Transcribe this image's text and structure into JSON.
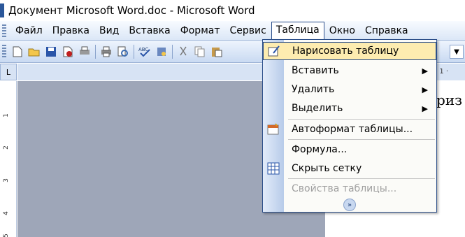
{
  "window": {
    "title": "Документ Microsoft Word.doc - Microsoft Word"
  },
  "menubar": {
    "items": [
      {
        "label": "Файл"
      },
      {
        "label": "Правка"
      },
      {
        "label": "Вид"
      },
      {
        "label": "Вставка"
      },
      {
        "label": "Формат"
      },
      {
        "label": "Сервис"
      },
      {
        "label": "Таблица"
      },
      {
        "label": "Окно"
      },
      {
        "label": "Справка"
      }
    ]
  },
  "toolbar": {
    "icons": [
      "new-document-icon",
      "open-icon",
      "save-icon",
      "permission-icon",
      "print-preview-icon",
      "print-icon",
      "research-icon",
      "spelling-icon",
      "cut-icon",
      "copy-icon",
      "paste-icon"
    ],
    "dropdown_arrow": "▼"
  },
  "ruler": {
    "corner": "L",
    "right_marks": "· 1 ·",
    "v_marks": [
      "1",
      "2",
      "3",
      "4",
      "5"
    ]
  },
  "document": {
    "visible_text": "ориз"
  },
  "table_menu": {
    "items": [
      {
        "label": "Нарисовать таблицу",
        "icon": "draw-table-icon",
        "highlight": true
      },
      {
        "label": "Вставить",
        "submenu": true
      },
      {
        "label": "Удалить",
        "submenu": true
      },
      {
        "label": "Выделить",
        "submenu": true
      },
      {
        "label": "Автоформат таблицы...",
        "icon": "autoformat-table-icon"
      },
      {
        "label": "Формула..."
      },
      {
        "label": "Скрыть сетку",
        "icon": "hide-gridlines-icon"
      },
      {
        "label": "Свойства таблицы...",
        "disabled": true
      }
    ],
    "expand_glyph": "»"
  },
  "colors": {
    "menu_highlight": "#fdecb0",
    "menu_border": "#2c4f8a",
    "workspace": "#9ea6b8"
  }
}
